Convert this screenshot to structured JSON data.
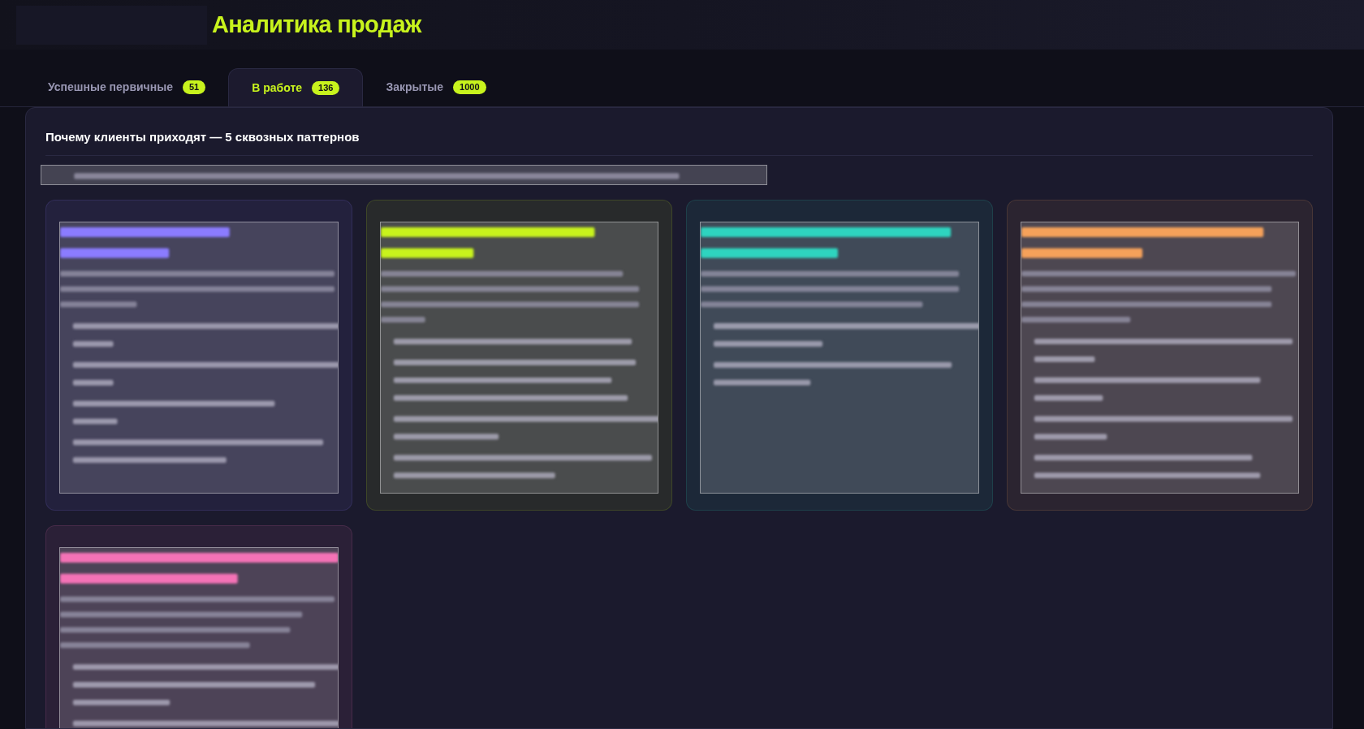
{
  "header": {
    "title": "Аналитика продаж"
  },
  "tabs": [
    {
      "label": "Успешные первичные",
      "count": "51",
      "selected": false
    },
    {
      "label": "В работе",
      "count": "136",
      "selected": true
    },
    {
      "label": "Закрытые",
      "count": "1000",
      "selected": false
    }
  ],
  "panel": {
    "title": "Почему клиенты приходят — 5 сквозных паттернов",
    "patterns": [
      {
        "color": "#8b7bff"
      },
      {
        "color": "#c8f31d"
      },
      {
        "color": "#2dd4bf"
      },
      {
        "color": "#f5a15a"
      },
      {
        "color": "#f472b6"
      }
    ]
  }
}
